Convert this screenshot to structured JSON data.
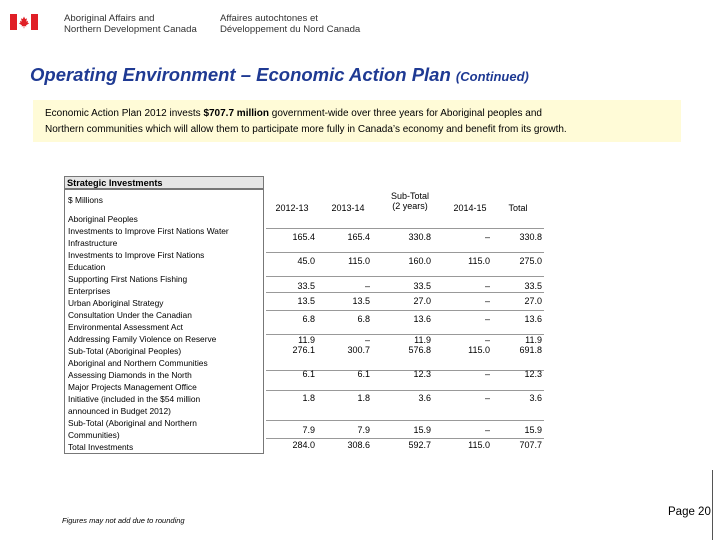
{
  "header": {
    "org_en": [
      "Aboriginal Affairs and",
      "Northern Development Canada"
    ],
    "org_fr": [
      "Affaires autochtones et",
      "Développement du Nord Canada"
    ],
    "flag_color": "#e01f26"
  },
  "title": "Operating Environment – Economic Action Plan",
  "title_continued": "(Continued)",
  "intro": {
    "part1": "Economic Action Plan 2012 invests ",
    "amount": "$707.7 million",
    "part2": " government-wide over three years for Aboriginal peoples and",
    "line2": "Northern communities which will allow them to participate more fully in Canada’s economy and benefit from its growth."
  },
  "table": {
    "caption": "Strategic Investments",
    "unit_label": "$ Millions",
    "columns": [
      "2012-13",
      "2013-14",
      [
        "Sub-Total",
        "(2 years)"
      ],
      "2014-15",
      "Total"
    ],
    "labels": [
      "Aboriginal Peoples",
      "Investments to Improve First Nations Water",
      "Infrastructure",
      "Investments to Improve First Nations",
      "Education",
      "Supporting First Nations Fishing",
      "Enterprises",
      "Urban Aboriginal Strategy",
      "Consultation Under the Canadian",
      "Environmental Assessment Act",
      "Addressing Family Violence on Reserve",
      "Sub-Total (Aboriginal Peoples)",
      "Aboriginal and Northern Communities",
      "Assessing Diamonds in the North",
      "Major Projects Management Office",
      "Initiative (included in the $54 million",
      "announced in Budget 2012)",
      "Sub-Total (Aboriginal and Northern",
      "Communities)",
      "Total Investments"
    ],
    "rows": [
      {
        "values": [
          "165.4",
          "165.4",
          "330.8",
          "–",
          "330.8"
        ]
      },
      {
        "values": [
          "45.0",
          "115.0",
          "160.0",
          "115.0",
          "275.0"
        ]
      },
      {
        "values": [
          "33.5",
          "–",
          "33.5",
          "–",
          "33.5"
        ]
      },
      {
        "values": [
          "13.5",
          "13.5",
          "27.0",
          "–",
          "27.0"
        ]
      },
      {
        "values": [
          "6.8",
          "6.8",
          "13.6",
          "–",
          "13.6"
        ]
      },
      {
        "values": [
          "11.9",
          "–",
          "11.9",
          "–",
          "11.9"
        ]
      },
      {
        "values": [
          "276.1",
          "300.7",
          "576.8",
          "115.0",
          "691.8"
        ]
      },
      {
        "values": [
          "6.1",
          "6.1",
          "12.3",
          "–",
          "12.3"
        ]
      },
      {
        "values": [
          "1.8",
          "1.8",
          "3.6",
          "–",
          "3.6"
        ]
      },
      {
        "values": [
          "7.9",
          "7.9",
          "15.9",
          "–",
          "15.9"
        ]
      },
      {
        "values": [
          "284.0",
          "308.6",
          "592.7",
          "115.0",
          "707.7"
        ]
      }
    ]
  },
  "footnote": "Figures may not add due to rounding",
  "page": "Page 20"
}
